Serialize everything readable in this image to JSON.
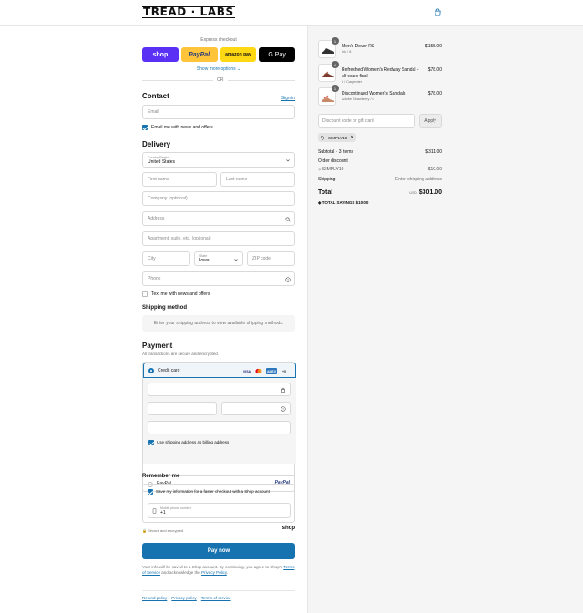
{
  "header": {
    "logo": "TREAD · LABS",
    "cart_icon": "shopping-bag-icon"
  },
  "express": {
    "label": "Express checkout",
    "buttons": {
      "shop": "shop",
      "paypal": "PayPal",
      "amazon": "amazon pay",
      "gpay": "G Pay"
    },
    "more_options": "Show more options ⌄",
    "or": "OR"
  },
  "contact": {
    "title": "Contact",
    "sign_in": "Sign in",
    "email_placeholder": "Email",
    "news_label": "Email me with news and offers",
    "news_checked": true
  },
  "delivery": {
    "title": "Delivery",
    "country_label": "Country/Region",
    "country_value": "United States",
    "first_name": "First name",
    "last_name": "Last name",
    "company": "Company (optional)",
    "address": "Address",
    "apartment": "Apartment, suite, etc. (optional)",
    "city": "City",
    "state_label": "State",
    "state_value": "Iowa",
    "zip": "ZIP code",
    "phone": "Phone",
    "text_label": "Text me with news and offers",
    "text_checked": false
  },
  "shipping": {
    "title": "Shipping method",
    "message": "Enter your shipping address to view available shipping methods."
  },
  "payment": {
    "title": "Payment",
    "subtitle": "All transactions are secure and encrypted.",
    "credit_card_label": "Credit card",
    "brands": [
      "VISA",
      "MC",
      "AMEX",
      "+5"
    ],
    "billing_label": "Use shipping address as billing address",
    "billing_checked": true,
    "paypal_label": "PayPal",
    "paypal_logo": "PayPal"
  },
  "remember": {
    "title": "Remember me",
    "save_label": "Save my information for a faster checkout with a Shop account",
    "phone_label": "Mobile phone number",
    "phone_value": "+1",
    "secure_label": "Secure and encrypted",
    "shop_logo": "shop"
  },
  "pay_now": "Pay now",
  "legal": {
    "text1": "Your info will be saved to a Shop account. By continuing, you agree to Shop's",
    "terms": "Terms of Service",
    "text2": " and acknowledge the ",
    "privacy": "Privacy Policy",
    "text3": "."
  },
  "footer_links": [
    "Refund policy",
    "Privacy policy",
    "Terms of service"
  ],
  "cart": {
    "items": [
      {
        "qty": "1",
        "name": "Men's Dover RS",
        "variant": "Ink / 8",
        "price": "$155.00"
      },
      {
        "qty": "4",
        "name": "Refreshed Women's Redway Sandal - all sales final",
        "variant": "8 / Carpenter",
        "price": "$78.00"
      },
      {
        "qty": "1",
        "name": "Discontinued Women's Sandals",
        "variant": "Adobe Strawberry / 6",
        "price": "$78.00"
      }
    ],
    "discount_placeholder": "Discount code or gift card",
    "apply": "Apply",
    "code_tag": "SIMPLY10",
    "subtotal_label": "Subtotal · 3 items",
    "subtotal_value": "$311.00",
    "order_discount_label": "Order discount",
    "discount_code": "SIMPLY10",
    "discount_value": "– $10.00",
    "shipping_label": "Shipping",
    "shipping_value": "Enter shipping address",
    "total_label": "Total",
    "currency": "USD",
    "total_value": "$301.00",
    "savings_label": "TOTAL SAVINGS",
    "savings_value": "$10.00"
  }
}
